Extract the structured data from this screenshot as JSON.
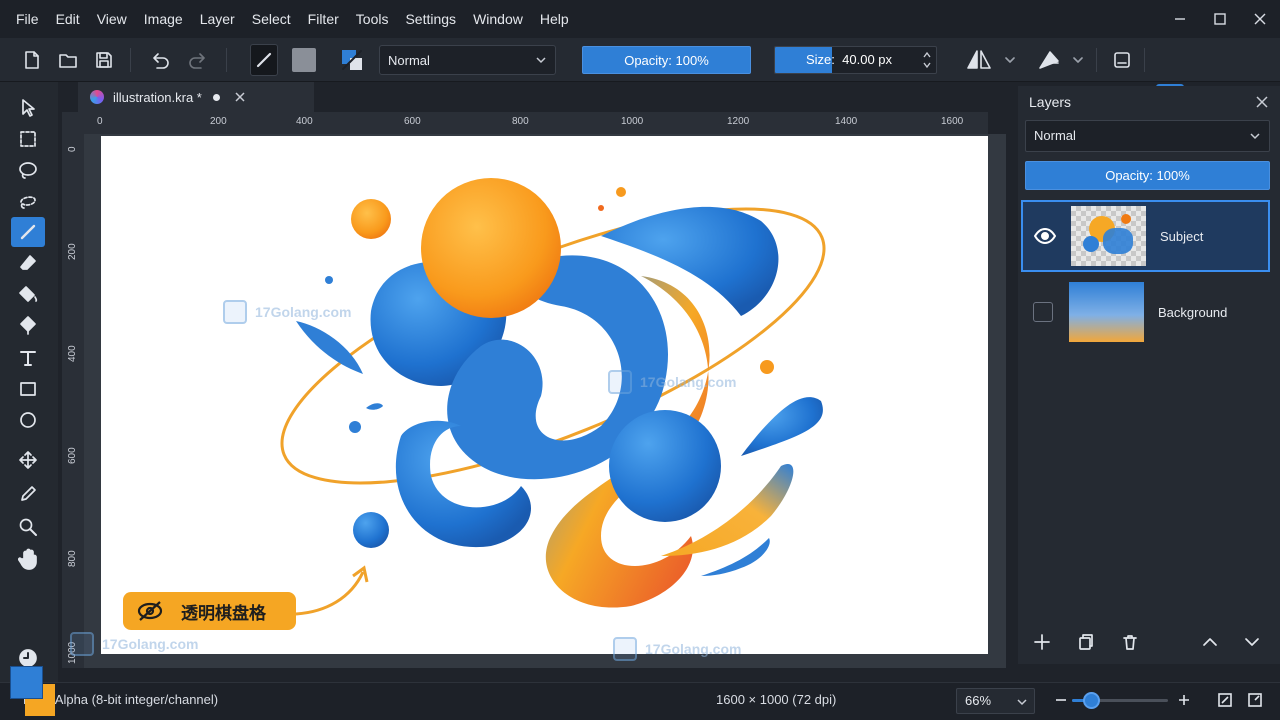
{
  "menu": [
    "File",
    "Edit",
    "View",
    "Image",
    "Layer",
    "Select",
    "Filter",
    "Tools",
    "Settings",
    "Window",
    "Help"
  ],
  "toolbar": {
    "blend_mode": "Normal",
    "opacity": "Opacity: 100%",
    "size_label": "Size:",
    "size_value": "40.00 px"
  },
  "document": {
    "tab_title": "illustration.kra *"
  },
  "rulers": {
    "horizontal": [
      "0",
      "200",
      "400",
      "600",
      "800",
      "1000",
      "1200",
      "1400",
      "1600"
    ],
    "vertical": [
      "0",
      "200",
      "400",
      "600",
      "800",
      "1000"
    ]
  },
  "canvas": {
    "badge_text": "透明棋盘格"
  },
  "watermarks": [
    "17Golang.com",
    "17Golang.com",
    "17Golang.com",
    "17Golang.com"
  ],
  "layers_panel": {
    "title": "Layers",
    "blend_mode": "Normal",
    "opacity": "Opacity: 100%",
    "layers": [
      {
        "name": "Subject",
        "visible": true,
        "selected": true
      },
      {
        "name": "Background",
        "visible": false,
        "selected": false
      }
    ]
  },
  "status": {
    "color_mode": "RGB/Alpha (8-bit integer/channel)",
    "dimensions": "1600 × 1000 (72 dpi)",
    "zoom": "66%",
    "zoom_level": 0.2
  },
  "colors": {
    "accent": "#2f7fd6",
    "foreground": "#2f7fd6",
    "background": "#f5a623"
  }
}
